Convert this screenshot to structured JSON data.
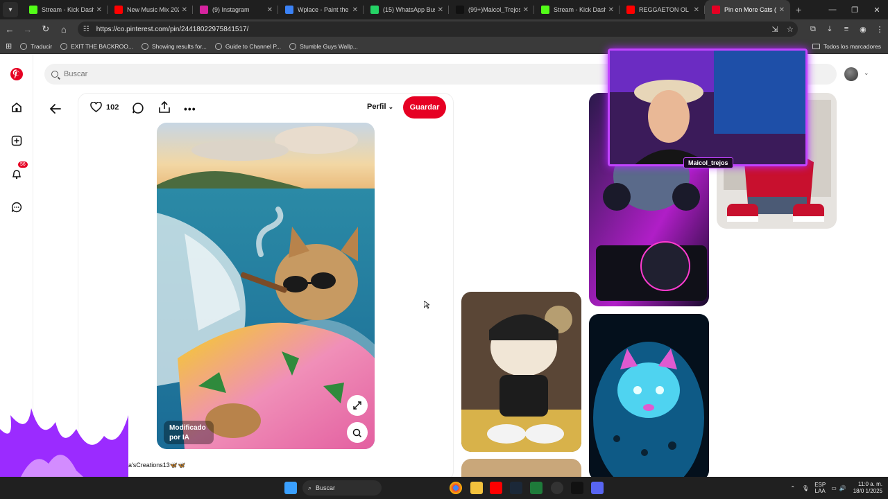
{
  "browser": {
    "tabs": [
      {
        "title": "Stream - Kick Dashbo",
        "favicon": "kick-icon",
        "color": "#53fc18",
        "active": false
      },
      {
        "title": "New Music Mix 2025",
        "favicon": "youtube-icon",
        "color": "#ff0000",
        "active": false
      },
      {
        "title": "(9) Instagram",
        "favicon": "instagram-icon",
        "color": "#d6249f",
        "active": false
      },
      {
        "title": "Wplace - Paint the w",
        "favicon": "globe-icon",
        "color": "#3b82f6",
        "active": false
      },
      {
        "title": "(15) WhatsApp Busin",
        "favicon": "whatsapp-icon",
        "color": "#25d366",
        "active": false
      },
      {
        "title": "(99+)Maicol_Trejos (",
        "favicon": "tiktok-icon",
        "color": "#111111",
        "active": false
      },
      {
        "title": "Stream - Kick Dashbo",
        "favicon": "kick-icon",
        "color": "#53fc18",
        "active": false
      },
      {
        "title": "REGGAETON OL",
        "favicon": "youtube-icon",
        "color": "#ff0000",
        "active": false
      },
      {
        "title": "Pin en More Cats (pa",
        "favicon": "pinterest-icon",
        "color": "#e60023",
        "active": true
      }
    ],
    "url": "https://co.pinterest.com/pin/24418022975841517/",
    "bookmarks": [
      "Traducir",
      "EXIT THE BACKROO...",
      "Showing results for...",
      "Guide to Channel P...",
      "Stumble Guys Wallp..."
    ],
    "all_bookmarks": "Todos los marcadores"
  },
  "pinterest": {
    "search_placeholder": "Buscar",
    "notification_count": "56",
    "likes": "102",
    "profile_label": "Perfil",
    "save_label": "Guardar",
    "ai_chip": "Modificado por IA",
    "author": "ja'sCreations13🦋🦋",
    "brand_color": "#e60023"
  },
  "overlay": {
    "streamer_name": "Maicol_trejos"
  },
  "taskbar": {
    "search_label": "Buscar",
    "lang_top": "ESP",
    "lang_bottom": "LAA",
    "time": "11:0 a. m.",
    "date": "18/0 1/2025"
  }
}
